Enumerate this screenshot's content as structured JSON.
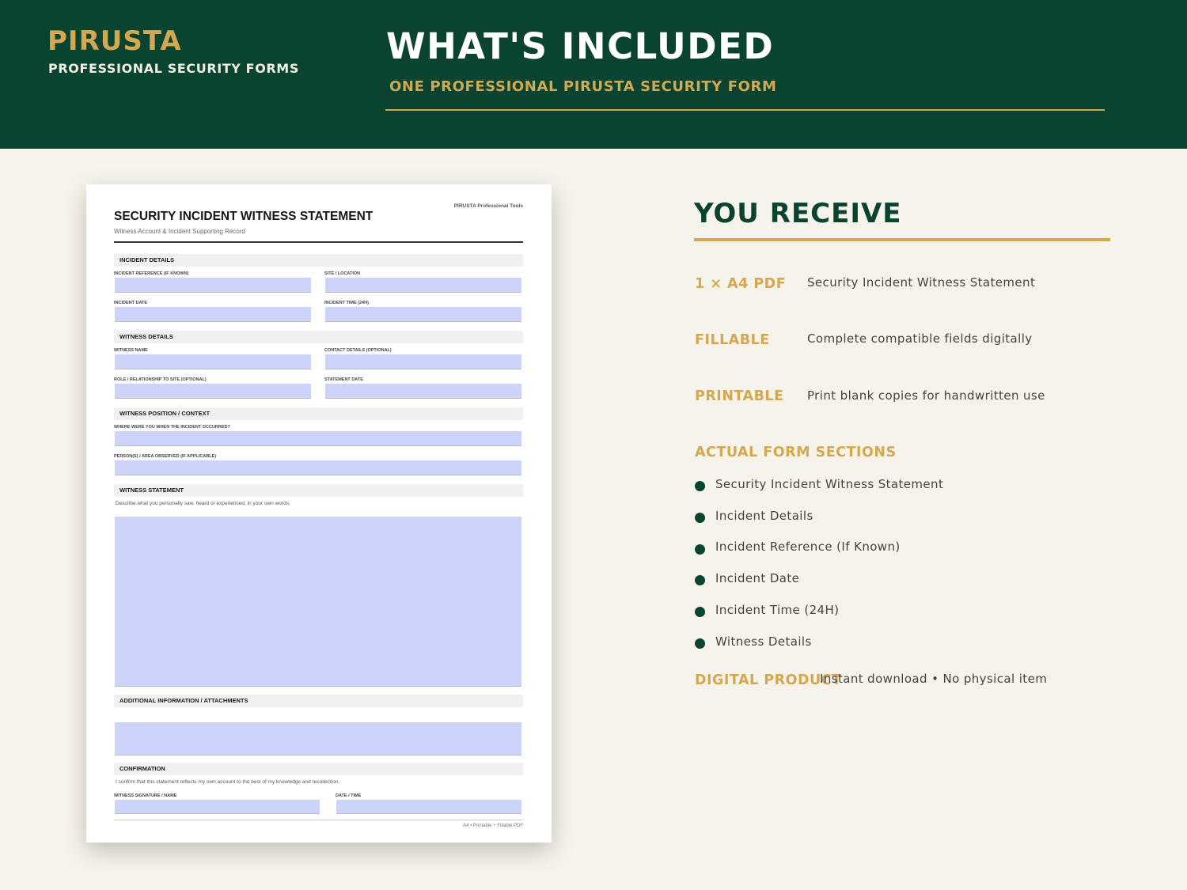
{
  "header": {
    "brand": "PIRUSTA",
    "brand_sub": "PROFESSIONAL SECURITY FORMS",
    "title": "WHAT'S INCLUDED",
    "subtitle": "ONE PROFESSIONAL PIRUSTA SECURITY FORM"
  },
  "form": {
    "tag": "PIRUSTA Professional Tools",
    "title": "SECURITY INCIDENT WITNESS STATEMENT",
    "subtitle": "Witness Account & Incident Supporting Record",
    "sections": {
      "incident": "INCIDENT DETAILS",
      "witness": "WITNESS DETAILS",
      "position": "WITNESS POSITION / CONTEXT",
      "statement": "WITNESS STATEMENT",
      "additional": "ADDITIONAL INFORMATION / ATTACHMENTS",
      "confirmation": "CONFIRMATION"
    },
    "labels": {
      "incident_ref": "INCIDENT REFERENCE (IF KNOWN)",
      "site": "SITE / LOCATION",
      "incident_date": "INCIDENT DATE",
      "incident_time": "INCIDENT TIME (24H)",
      "witness_name": "WITNESS NAME",
      "contact": "CONTACT DETAILS (OPTIONAL)",
      "role": "ROLE / RELATIONSHIP TO SITE (OPTIONAL)",
      "statement_date": "STATEMENT DATE",
      "where": "WHERE WERE YOU WHEN THE INCIDENT OCCURRED?",
      "persons": "PERSON(S) / AREA OBSERVED (IF APPLICABLE)",
      "signature": "WITNESS SIGNATURE / NAME",
      "date_time": "DATE / TIME"
    },
    "statement_note": "Describe what you personally saw, heard or experienced, in your own words.",
    "confirm_note": "I confirm that this statement reflects my own account to the best of my knowledge and recollection.",
    "footer": "A4 • Printable + Fillable PDF"
  },
  "receive": {
    "title": "YOU RECEIVE",
    "items": [
      {
        "key": "1 × A4 PDF",
        "value": "Security Incident Witness Statement"
      },
      {
        "key": "FILLABLE",
        "value": "Complete compatible fields digitally"
      },
      {
        "key": "PRINTABLE",
        "value": "Print blank copies for handwritten use"
      }
    ],
    "sections_title": "ACTUAL FORM SECTIONS",
    "sections": [
      "Security Incident Witness Statement",
      "Incident Details",
      "Incident Reference (If Known)",
      "Incident Date",
      "Incident Time (24H)",
      "Witness Details"
    ],
    "digital_key": "DIGITAL PRODUCT",
    "digital_value": "Instant download • No physical item"
  },
  "colors": {
    "brand_green": "#0a4430",
    "gold": "#d2a851",
    "field_fill": "#ccd4fb",
    "background": "#f6f3ea"
  }
}
